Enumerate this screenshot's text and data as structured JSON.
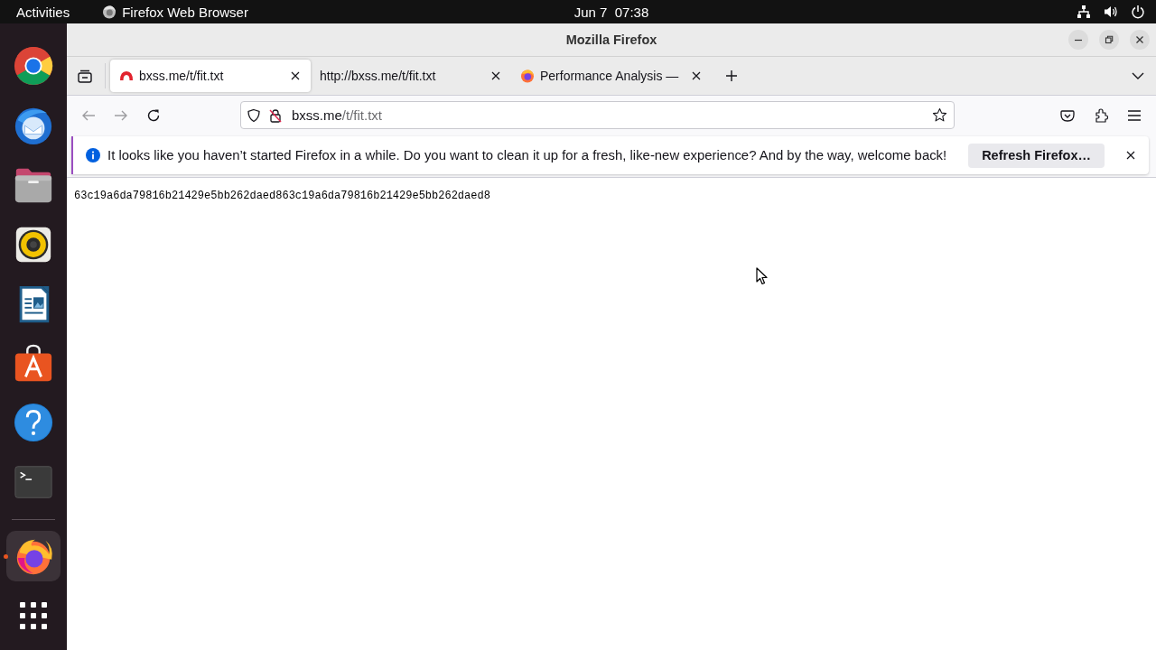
{
  "top_bar": {
    "activities": "Activities",
    "app_menu": "Firefox Web Browser",
    "clock": "Jun 7  07:38"
  },
  "dock": {
    "items": [
      {
        "kind": "chrome",
        "running": false,
        "selected": false
      },
      {
        "kind": "mail",
        "running": false,
        "selected": false
      },
      {
        "kind": "files",
        "running": false,
        "selected": false
      },
      {
        "kind": "music",
        "running": false,
        "selected": false
      },
      {
        "kind": "writer",
        "running": false,
        "selected": false
      },
      {
        "kind": "store",
        "running": false,
        "selected": false
      },
      {
        "kind": "help",
        "running": false,
        "selected": false
      },
      {
        "kind": "terminal",
        "running": false,
        "selected": false
      },
      {
        "kind": "separator"
      },
      {
        "kind": "firefox",
        "running": true,
        "selected": true
      }
    ]
  },
  "window": {
    "title": "Mozilla Firefox"
  },
  "tabs": [
    {
      "kind": "site",
      "title": "bxss.me/t/fit.txt",
      "selected": true
    },
    {
      "kind": "plain",
      "title": "http://bxss.me/t/fit.txt",
      "selected": false
    },
    {
      "kind": "firefox",
      "title": "Performance Analysis —",
      "selected": false
    }
  ],
  "nav": {
    "back": {
      "disabled": true
    },
    "forward": {
      "disabled": true
    },
    "url": {
      "host": "bxss.me",
      "path": "/t/fit.txt",
      "secure": false
    }
  },
  "notification": {
    "message": "It looks like you haven’t started Firefox in a while. Do you want to clean it up for a fresh, like-new experience? And by the way, welcome back!",
    "button": "Refresh Firefox…"
  },
  "content": {
    "text": "63c19a6da79816b21429e5bb262daed863c19a6da79816b21429e5bb262daed8"
  }
}
